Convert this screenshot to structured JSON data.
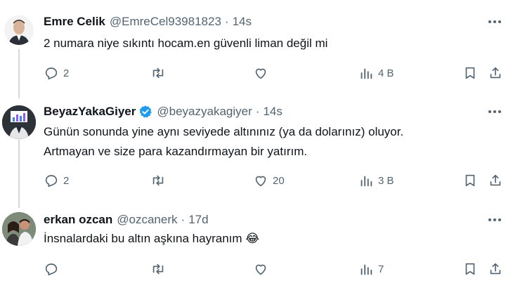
{
  "tweets": [
    {
      "name": "Emre Celik",
      "handle": "@EmreCel93981823",
      "separator": "·",
      "time": "14s",
      "verified": false,
      "lines": [
        "2 numara niye sıkıntı hocam.en güvenli liman değil mi"
      ],
      "reply_count": "2",
      "retweet_count": "",
      "like_count": "",
      "views": "4 B"
    },
    {
      "name": "BeyazYakaGiyer",
      "handle": "@beyazyakagiyer",
      "separator": "·",
      "time": "14s",
      "verified": true,
      "lines": [
        "Günün sonunda yine aynı seviyede altınınız (ya da dolarınız) oluyor.",
        "Artmayan ve size para kazandırmayan bir yatırım."
      ],
      "reply_count": "2",
      "retweet_count": "",
      "like_count": "20",
      "views": "3 B"
    },
    {
      "name": "erkan ozcan",
      "handle": "@ozcanerk",
      "separator": "·",
      "time": "17d",
      "verified": false,
      "lines": [
        "İnsnalardaki bu altın aşkına hayranım 😂"
      ],
      "reply_count": "",
      "retweet_count": "",
      "like_count": "",
      "views": "7"
    }
  ],
  "colors": {
    "text": "#0f1419",
    "muted": "#536471",
    "verified": "#1d9bf0",
    "thread_line": "#cfd9de"
  },
  "icons": [
    "reply-icon",
    "retweet-icon",
    "like-icon",
    "views-icon",
    "bookmark-icon",
    "share-icon",
    "more-icon",
    "verified-badge-icon"
  ]
}
